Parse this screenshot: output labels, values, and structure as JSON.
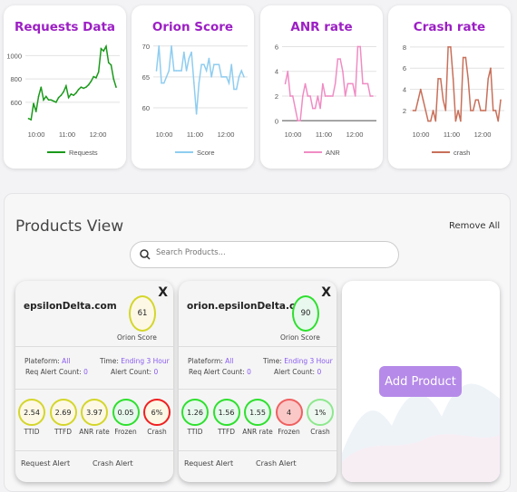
{
  "charts": [
    {
      "title": "Requests Data",
      "legend": "Requests",
      "color": "#1a9a1a",
      "type": "line",
      "x_start": "09:45",
      "x_end": "12:35",
      "xticks": [
        "10:00",
        "11:00",
        "12:00"
      ],
      "yticks": [
        600,
        800,
        1000
      ],
      "ylim": [
        420,
        1120
      ],
      "values": [
        460,
        450,
        590,
        520,
        650,
        730,
        620,
        650,
        620,
        620,
        610,
        600,
        640,
        660,
        690,
        740,
        640,
        670,
        660,
        680,
        710,
        730,
        720,
        730,
        750,
        780,
        820,
        810,
        860,
        1060,
        1040,
        1080,
        940,
        920,
        800,
        730
      ]
    },
    {
      "title": "Orion Score",
      "legend": "Score",
      "color": "#8fcdf0",
      "type": "line",
      "x_start": "09:45",
      "x_end": "12:35",
      "xticks": [
        "10:00",
        "11:00",
        "12:00"
      ],
      "yticks": [
        60,
        65,
        70
      ],
      "ylim": [
        57.5,
        70.7
      ],
      "values": [
        66,
        70,
        64,
        64,
        65,
        66,
        70,
        66,
        66,
        66,
        66,
        69,
        66,
        68,
        69,
        64,
        59,
        64,
        67,
        67,
        66,
        68,
        65,
        67,
        67,
        67,
        65,
        65,
        65,
        64,
        67,
        63,
        63,
        65,
        66,
        65
      ]
    },
    {
      "title": "ANR rate",
      "legend": "ANR",
      "color": "#f08cc4",
      "type": "line",
      "x_start": "09:45",
      "x_end": "12:35",
      "xticks": [
        "10:00",
        "11:00",
        "12:00"
      ],
      "yticks": [
        0,
        2,
        4,
        6
      ],
      "ylim": [
        -0.2,
        6.4
      ],
      "values": [
        3,
        4,
        2,
        2,
        1,
        0,
        0,
        2,
        3,
        2,
        2,
        1,
        1,
        2,
        1,
        3,
        2,
        2,
        2,
        2,
        3,
        5,
        5,
        4,
        2,
        3,
        3,
        3,
        2,
        6,
        6,
        3,
        3,
        3,
        2,
        2
      ]
    },
    {
      "title": "Crash rate",
      "legend": "crash",
      "color": "#c8705a",
      "type": "line",
      "x_start": "09:45",
      "x_end": "12:35",
      "xticks": [
        "10:00",
        "11:00",
        "12:00"
      ],
      "yticks": [
        2,
        4,
        6,
        8
      ],
      "ylim": [
        0.8,
        8.5
      ],
      "values": [
        2,
        2,
        3,
        4,
        3,
        2,
        1,
        1,
        2,
        1,
        5,
        5,
        3,
        2,
        8,
        8,
        5,
        1,
        2,
        1,
        7,
        7,
        5,
        2,
        2,
        3,
        3,
        2,
        2,
        2,
        5,
        6,
        2,
        2,
        1,
        3
      ]
    }
  ],
  "products": {
    "title": "Products View",
    "remove_all": "Remove All",
    "search_placeholder": "Search Products...",
    "add_product": "Add Product",
    "cards": [
      {
        "name": "epsilonDelta.com",
        "close": "X",
        "score": "61",
        "score_label": "Orion Score",
        "score_color": "#d4d62a",
        "score_bg": "#fdf8e6",
        "platform_label": "Plateform:",
        "platform": "All",
        "time_label": "Time:",
        "time": "Ending 3 Hour",
        "req_label": "Req Alert Count:",
        "req": "0",
        "alert_label": "Alert Count:",
        "alert": "0",
        "metrics": [
          {
            "value": "2.54",
            "label": "TTID",
            "color": "#d4d62a",
            "bg": "#fdf8e6"
          },
          {
            "value": "2.69",
            "label": "TTFD",
            "color": "#d4d62a",
            "bg": "#fdf8e6"
          },
          {
            "value": "3.97",
            "label": "ANR rate",
            "color": "#d4d62a",
            "bg": "#fdf8e6"
          },
          {
            "value": "0.05",
            "label": "Frozen",
            "color": "#2ee02e",
            "bg": "#e8f8ee"
          },
          {
            "value": "6%",
            "label": "Crash",
            "color": "#f02020",
            "bg": "#fdf8e6"
          }
        ],
        "request_alert": "Request Alert",
        "crash_alert": "Crash Alert"
      },
      {
        "name": "orion.epsilonDelta.com",
        "close": "X",
        "score": "90",
        "score_label": "Orion Score",
        "score_color": "#2ee02e",
        "score_bg": "#e8f8ee",
        "platform_label": "Plateform:",
        "platform": "All",
        "time_label": "Time:",
        "time": "Ending 3 Hour",
        "req_label": "Req Alert Count:",
        "req": "0",
        "alert_label": "Alert Count:",
        "alert": "0",
        "metrics": [
          {
            "value": "1.26",
            "label": "TTID",
            "color": "#2ee02e",
            "bg": "#e8f8ee"
          },
          {
            "value": "1.56",
            "label": "TTFD",
            "color": "#2ee02e",
            "bg": "#e8f8ee"
          },
          {
            "value": "1.55",
            "label": "ANR rate",
            "color": "#2ee02e",
            "bg": "#e8f8ee"
          },
          {
            "value": "4",
            "label": "Frozen",
            "color": "#f06060",
            "bg": "#fbc8c8"
          },
          {
            "value": "1%",
            "label": "Crash",
            "color": "#8ee88e",
            "bg": "#eef8f0"
          }
        ],
        "request_alert": "Request Alert",
        "crash_alert": "Crash Alert"
      }
    ]
  }
}
